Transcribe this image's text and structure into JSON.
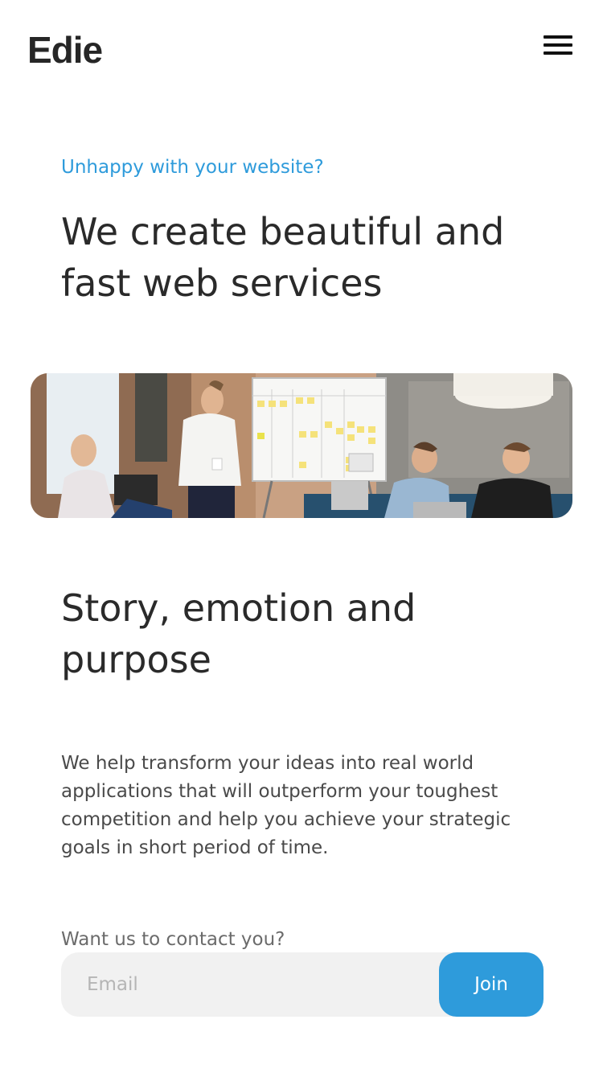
{
  "header": {
    "logo": "Edie",
    "menu_icon": "hamburger-menu-icon"
  },
  "hero": {
    "eyebrow": "Unhappy with your website?",
    "headline": "We create beautiful and fast web services",
    "image_alt": "team-meeting-photo"
  },
  "story": {
    "title": "Story, emotion and purpose",
    "body": "We help transform your ideas into real world applications that will outperform your toughest competition and help you achieve your strategic goals in short period of time."
  },
  "contact": {
    "label": "Want us to contact you?",
    "email_placeholder": "Email",
    "join_label": "Join"
  },
  "colors": {
    "accent": "#2e9bdb",
    "text": "#2a2a2a",
    "input_bg": "#f1f1f1"
  }
}
